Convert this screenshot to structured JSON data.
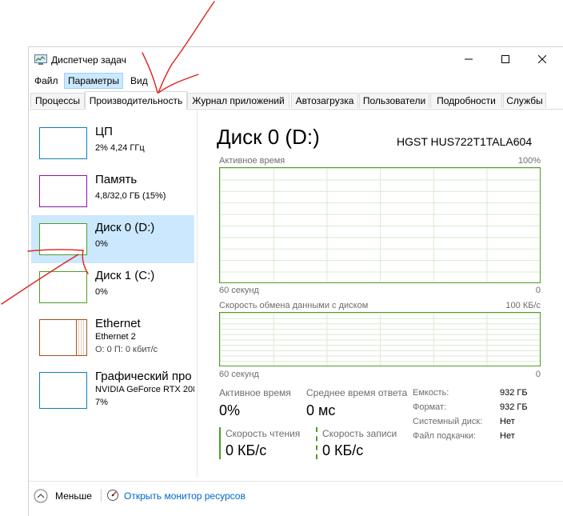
{
  "window": {
    "title": "Диспетчер задач"
  },
  "menu": [
    "Файл",
    "Параметры",
    "Вид"
  ],
  "tabs": [
    "Процессы",
    "Производительность",
    "Журнал приложений",
    "Автозагрузка",
    "Пользователи",
    "Подробности",
    "Службы"
  ],
  "sidebar": [
    {
      "name": "ЦП",
      "line1": "2% 4,24 ГГц",
      "color": "#117dbb"
    },
    {
      "name": "Память",
      "line1": "4,8/32,0 ГБ (15%)",
      "color": "#8b12ae"
    },
    {
      "name": "Диск 0 (D:)",
      "line1": "0%",
      "color": "#4d9e22"
    },
    {
      "name": "Диск 1 (C:)",
      "line1": "0%",
      "color": "#4d9e22"
    },
    {
      "name": "Ethernet",
      "line1": "Ethernet 2",
      "line2": "О: 0 П: 0 кбит/с",
      "color": "#a7501b"
    },
    {
      "name": "Графический про",
      "line1": "NVIDIA GeForce RTX 208",
      "line2": "7%",
      "color": "#117dbb"
    }
  ],
  "main": {
    "title": "Диск 0 (D:)",
    "model": "HGST HUS722T1TALA604",
    "graph1": {
      "label": "Активное время",
      "max": "100%",
      "xlabel": "60 секунд",
      "min": "0"
    },
    "graph2": {
      "label": "Скорость обмена данными с диском",
      "max": "100 КБ/с",
      "xlabel": "60 секунд",
      "min": "0"
    },
    "stats": {
      "active_label": "Активное время",
      "active_value": "0%",
      "resp_label": "Среднее время ответа",
      "resp_value": "0 мс",
      "read_label": "Скорость чтения",
      "read_value": "0 КБ/с",
      "write_label": "Скорость записи",
      "write_value": "0 КБ/с"
    },
    "props": [
      {
        "k": "Емкость:",
        "v": "932 ГБ"
      },
      {
        "k": "Формат:",
        "v": "932 ГБ"
      },
      {
        "k": "Системный диск:",
        "v": "Нет"
      },
      {
        "k": "Файл подкачки:",
        "v": "Нет"
      }
    ]
  },
  "footer": {
    "less": "Меньше",
    "monitor": "Открыть монитор ресурсов"
  }
}
